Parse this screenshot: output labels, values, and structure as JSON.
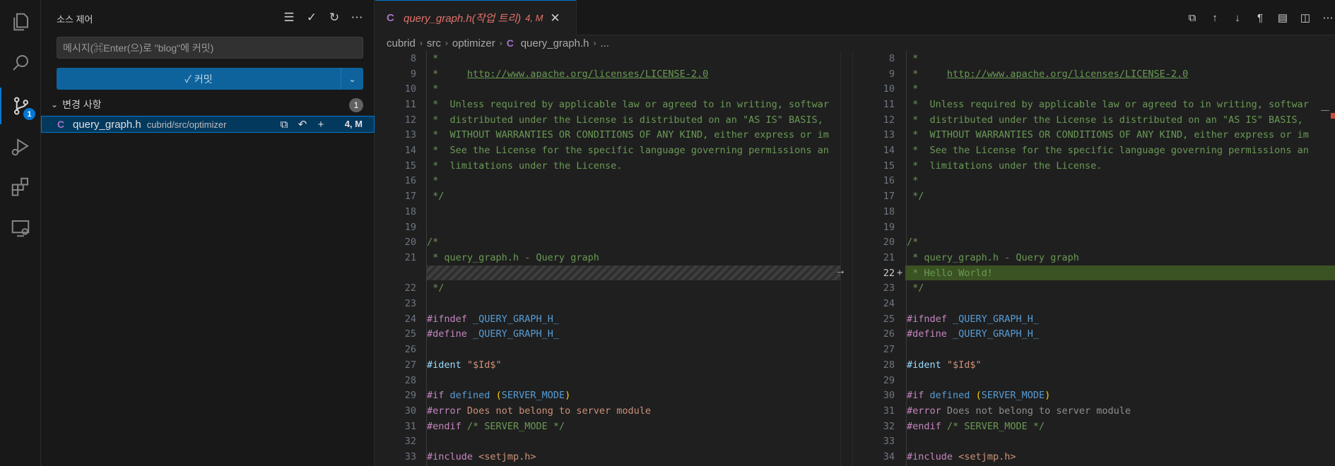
{
  "activity_bar": {
    "items": [
      "explorer-icon",
      "search-icon",
      "source-control-icon",
      "run-debug-icon",
      "extensions-icon",
      "remote-explorer-icon"
    ],
    "badge": "1"
  },
  "sidebar": {
    "title": "소스 제어",
    "actions": [
      "list-view-icon",
      "check-icon",
      "refresh-icon",
      "more-icon"
    ],
    "commit_placeholder": "메시지(⌘Enter(으)로 \"blog\"에 커밋)",
    "commit_label": "✓ 커밋",
    "changes_label": "변경 사항",
    "changes_count": "1",
    "file": {
      "name": "query_graph.h",
      "path": "cubrid/src/optimizer",
      "status": "4, M"
    }
  },
  "editor": {
    "tab": {
      "label": "query_graph.h(작업 트리)",
      "status": "4, M",
      "close": "✕"
    },
    "breadcrumb": [
      "cubrid",
      "src",
      "optimizer",
      "query_graph.h",
      "..."
    ],
    "left_lines": [
      {
        "n": "8",
        "t": " *"
      },
      {
        "n": "9",
        "t": " *     http://www.apache.org/licenses/LICENSE-2.0"
      },
      {
        "n": "10",
        "t": " *"
      },
      {
        "n": "11",
        "t": " *  Unless required by applicable law or agreed to in writing, softwar"
      },
      {
        "n": "12",
        "t": " *  distributed under the License is distributed on an \"AS IS\" BASIS,"
      },
      {
        "n": "13",
        "t": " *  WITHOUT WARRANTIES OR CONDITIONS OF ANY KIND, either express or im"
      },
      {
        "n": "14",
        "t": " *  See the License for the specific language governing permissions an"
      },
      {
        "n": "15",
        "t": " *  limitations under the License."
      },
      {
        "n": "16",
        "t": " *"
      },
      {
        "n": "17",
        "t": " */"
      },
      {
        "n": "18",
        "t": ""
      },
      {
        "n": "19",
        "t": ""
      },
      {
        "n": "20",
        "t": "/*"
      },
      {
        "n": "21",
        "t": " * query_graph.h - Query graph"
      },
      {
        "n": "",
        "t": ""
      },
      {
        "n": "22",
        "t": " */"
      },
      {
        "n": "23",
        "t": ""
      },
      {
        "n": "24",
        "t": "#ifndef _QUERY_GRAPH_H_"
      },
      {
        "n": "25",
        "t": "#define _QUERY_GRAPH_H_"
      },
      {
        "n": "26",
        "t": ""
      },
      {
        "n": "27",
        "t": "#ident \"$Id$\""
      },
      {
        "n": "28",
        "t": ""
      },
      {
        "n": "29",
        "t": "#if defined (SERVER_MODE)"
      },
      {
        "n": "30",
        "t": "#error Does not belong to server module"
      },
      {
        "n": "31",
        "t": "#endif /* SERVER_MODE */"
      },
      {
        "n": "32",
        "t": ""
      },
      {
        "n": "33",
        "t": "#include <setjmp.h>"
      }
    ],
    "right_lines": [
      {
        "n": "8",
        "t": " *"
      },
      {
        "n": "9",
        "t": " *     http://www.apache.org/licenses/LICENSE-2.0"
      },
      {
        "n": "10",
        "t": " *"
      },
      {
        "n": "11",
        "t": " *  Unless required by applicable law or agreed to in writing, softwar"
      },
      {
        "n": "12",
        "t": " *  distributed under the License is distributed on an \"AS IS\" BASIS,"
      },
      {
        "n": "13",
        "t": " *  WITHOUT WARRANTIES OR CONDITIONS OF ANY KIND, either express or im"
      },
      {
        "n": "14",
        "t": " *  See the License for the specific language governing permissions an"
      },
      {
        "n": "15",
        "t": " *  limitations under the License."
      },
      {
        "n": "16",
        "t": " *"
      },
      {
        "n": "17",
        "t": " */"
      },
      {
        "n": "18",
        "t": ""
      },
      {
        "n": "19",
        "t": ""
      },
      {
        "n": "20",
        "t": "/*"
      },
      {
        "n": "21",
        "t": " * query_graph.h - Query graph"
      },
      {
        "n": "22",
        "t": " * Hello World!"
      },
      {
        "n": "23",
        "t": " */"
      },
      {
        "n": "24",
        "t": ""
      },
      {
        "n": "25",
        "t": "#ifndef _QUERY_GRAPH_H_"
      },
      {
        "n": "26",
        "t": "#define _QUERY_GRAPH_H_"
      },
      {
        "n": "27",
        "t": ""
      },
      {
        "n": "28",
        "t": "#ident \"$Id$\""
      },
      {
        "n": "29",
        "t": ""
      },
      {
        "n": "30",
        "t": "#if defined (SERVER_MODE)"
      },
      {
        "n": "31",
        "t": "#error Does not belong to server module"
      },
      {
        "n": "32",
        "t": "#endif /* SERVER_MODE */"
      },
      {
        "n": "33",
        "t": ""
      },
      {
        "n": "34",
        "t": "#include <setjmp.h>"
      }
    ]
  },
  "colors": {
    "accent": "#0078d4",
    "added_line": "#3b5323",
    "modified_tab": "#e2726a",
    "c_file": "#a074c4"
  }
}
